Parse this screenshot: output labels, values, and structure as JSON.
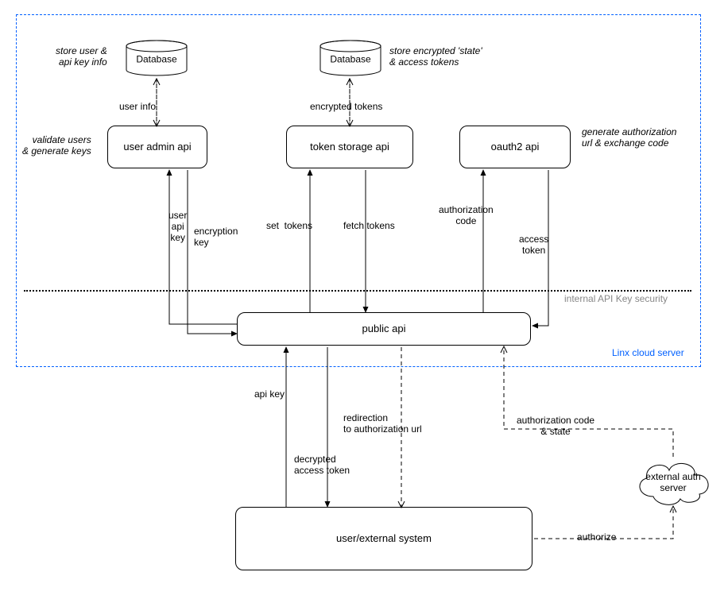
{
  "boundary": {
    "label": "Linx cloud server"
  },
  "security_line": {
    "label": "internal API Key security"
  },
  "databases": {
    "user_db": {
      "label": "Database",
      "note": "store user &\napi key info",
      "edge": "user info"
    },
    "token_db": {
      "label": "Database",
      "note": "store encrypted 'state'\n& access tokens",
      "edge": "encrypted tokens"
    }
  },
  "services": {
    "user_admin": {
      "label": "user admin\napi",
      "note": "validate users\n& generate keys"
    },
    "token_storage": {
      "label": "token storage\napi"
    },
    "oauth2": {
      "label": "oauth2 api",
      "note": "generate authorization\nurl & exchange code"
    },
    "public_api": {
      "label": "public api"
    },
    "external_system": {
      "label": "user/external system"
    },
    "external_auth": {
      "label": "external auth\nserver"
    }
  },
  "edges": {
    "user_api_key": "user\napi\nkey",
    "encryption_key": "encryption\nkey",
    "set_tokens": "set  tokens",
    "fetch_tokens": "fetch tokens",
    "authorization_code": "authorization\ncode",
    "access_token": "access\ntoken",
    "api_key": "api key",
    "redirect": "redirection\nto authorization url",
    "decrypted_token": "decrypted\naccess token",
    "auth_code_state": "authorization code\n& state",
    "authorize": "authorize"
  }
}
